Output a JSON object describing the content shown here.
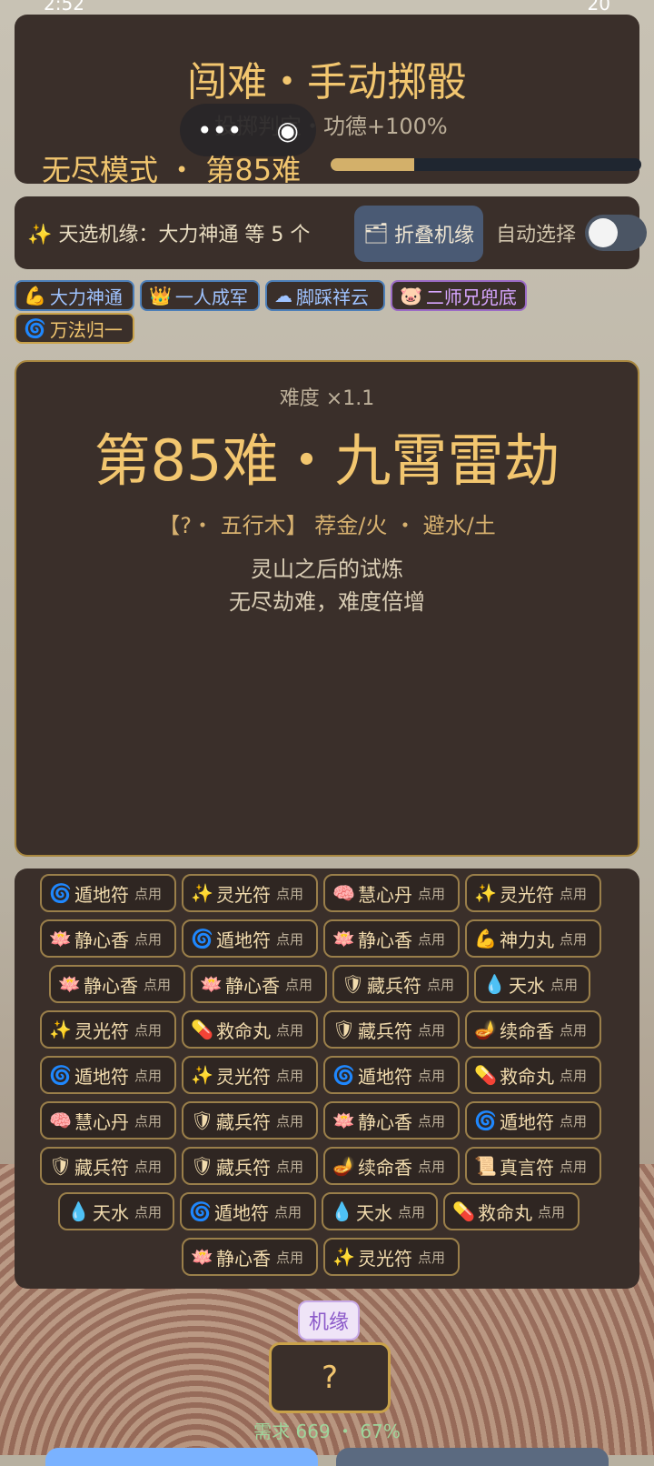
{
  "status": {
    "time": "2:52",
    "battery": "20"
  },
  "header": {
    "title": "闯难・手动掷骰",
    "subline": "投掷判定・功德+100%",
    "mode": "无尽模式 ・ 第85难",
    "progress_fraction": 0.27
  },
  "fate_bar": {
    "text": "✨ 天选机缘：大力神通 等 5 个",
    "fold_button": "折叠机缘",
    "auto_label": "自动选择",
    "auto_on": false
  },
  "chips": [
    {
      "icon": "💪",
      "label": "大力神通",
      "color": "blue"
    },
    {
      "icon": "👑",
      "label": "一人成军",
      "color": "blue"
    },
    {
      "icon": "☁",
      "label": "脚踩祥云",
      "color": "blue"
    },
    {
      "icon": "🐷",
      "label": "二师兄兜底",
      "color": "purple"
    },
    {
      "icon": "🌀",
      "label": "万法归一",
      "color": "gold"
    }
  ],
  "stage": {
    "difficulty": "难度 ×1.1",
    "title": "第85难・九霄雷劫",
    "elements": "【?・ 五行木】    荐金/火 ・ 避水/土",
    "desc_1": "灵山之后的试炼",
    "desc_2": "无尽劫难，难度倍增"
  },
  "items_use_label": "点用",
  "items": [
    {
      "icon": "🌀",
      "name": "遁地符"
    },
    {
      "icon": "✨",
      "name": "灵光符"
    },
    {
      "icon": "🧠",
      "name": "慧心丹"
    },
    {
      "icon": "✨",
      "name": "灵光符"
    },
    {
      "icon": "🪷",
      "name": "静心香"
    },
    {
      "icon": "🌀",
      "name": "遁地符"
    },
    {
      "icon": "🪷",
      "name": "静心香"
    },
    {
      "icon": "💪",
      "name": "神力丸"
    },
    {
      "icon": "🪷",
      "name": "静心香"
    },
    {
      "icon": "🪷",
      "name": "静心香"
    },
    {
      "icon": "🛡",
      "name": "藏兵符"
    },
    {
      "icon": "💧",
      "name": "天水"
    },
    {
      "icon": "✨",
      "name": "灵光符"
    },
    {
      "icon": "💊",
      "name": "救命丸"
    },
    {
      "icon": "🛡",
      "name": "藏兵符"
    },
    {
      "icon": "🪔",
      "name": "续命香"
    },
    {
      "icon": "🌀",
      "name": "遁地符"
    },
    {
      "icon": "✨",
      "name": "灵光符"
    },
    {
      "icon": "🌀",
      "name": "遁地符"
    },
    {
      "icon": "💊",
      "name": "救命丸"
    },
    {
      "icon": "🧠",
      "name": "慧心丹"
    },
    {
      "icon": "🛡",
      "name": "藏兵符"
    },
    {
      "icon": "🪷",
      "name": "静心香"
    },
    {
      "icon": "🌀",
      "name": "遁地符"
    },
    {
      "icon": "🛡",
      "name": "藏兵符"
    },
    {
      "icon": "🛡",
      "name": "藏兵符"
    },
    {
      "icon": "🪔",
      "name": "续命香"
    },
    {
      "icon": "📜",
      "name": "真言符"
    },
    {
      "icon": "💧",
      "name": "天水"
    },
    {
      "icon": "🌀",
      "name": "遁地符"
    },
    {
      "icon": "💧",
      "name": "天水"
    },
    {
      "icon": "💊",
      "name": "救命丸"
    },
    {
      "icon": "🪷",
      "name": "静心香"
    },
    {
      "icon": "✨",
      "name": "灵光符"
    }
  ],
  "jiyuan_label": "机缘",
  "dice": "?",
  "need_text": "需求 669 ・ 67%"
}
